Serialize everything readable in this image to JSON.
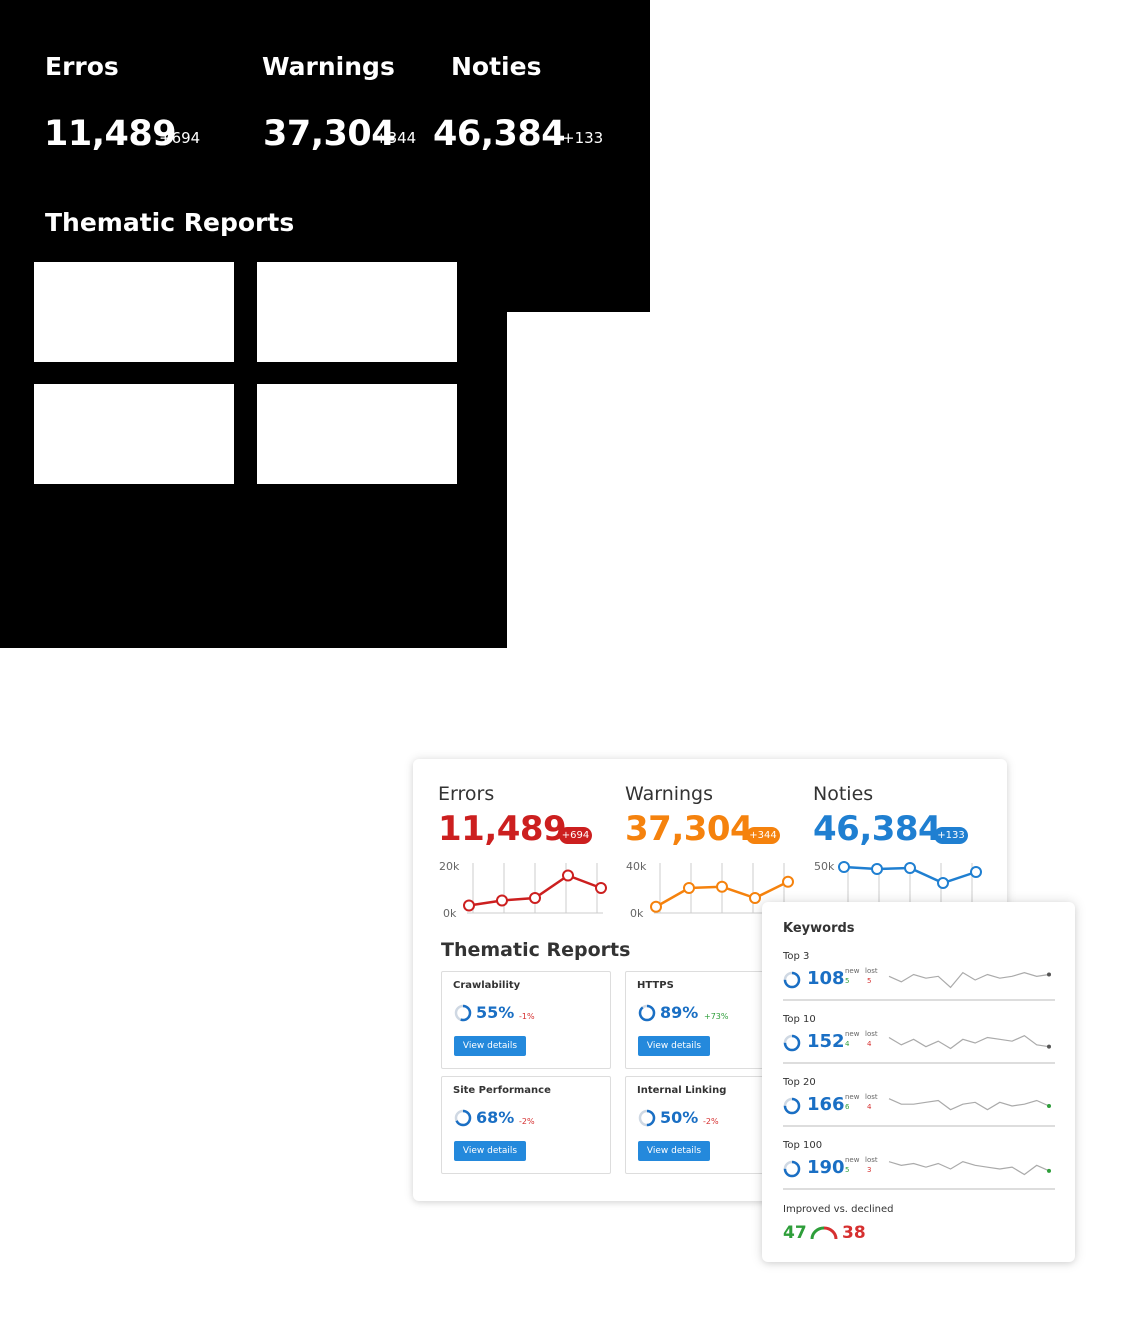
{
  "dark": {
    "errors_label": "Erros",
    "warnings_label": "Warnings",
    "notices_label": "Noties",
    "errors_value": "11,489",
    "errors_delta": "+694",
    "warnings_value": "37,304",
    "warnings_delta": "+344",
    "notices_value": "46,384",
    "notices_delta": "+133",
    "section_title": "Thematic Reports"
  },
  "card": {
    "errors": {
      "label": "Errors",
      "value": "11,489",
      "badge": "+694",
      "y_max": "20k",
      "y_min": "0k",
      "series": [
        3,
        5,
        6,
        15,
        10
      ],
      "max": 20,
      "color": "#cc1f1f"
    },
    "warnings": {
      "label": "Warnings",
      "value": "37,304",
      "badge": "+344",
      "y_max": "40k",
      "y_min": "0k",
      "series": [
        5,
        20,
        21,
        12,
        25
      ],
      "max": 40,
      "color": "#f5820d"
    },
    "notices": {
      "label": "Noties",
      "value": "46,384",
      "badge": "+133",
      "y_max": "50k",
      "y_min": "",
      "series": [
        46,
        44,
        45,
        30,
        41
      ],
      "max": 50,
      "color": "#1f7fd1"
    },
    "section_title": "Thematic Reports",
    "reports": [
      {
        "title": "Crawlability",
        "pct": "55%",
        "delta": "-1%",
        "value": 0.55,
        "button": "View details"
      },
      {
        "title": "HTTPS",
        "pct": "89%",
        "delta": "+73%",
        "value": 0.89,
        "button": "View details"
      },
      {
        "title": "Site Performance",
        "pct": "68%",
        "delta": "-2%",
        "value": 0.68,
        "button": "View details"
      },
      {
        "title": "Internal Linking",
        "pct": "50%",
        "delta": "-2%",
        "value": 0.5,
        "button": "View details"
      }
    ]
  },
  "keywords": {
    "title": "Keywords",
    "new_label": "new",
    "lost_label": "lost",
    "rows": [
      {
        "label": "Top 3",
        "value": "108",
        "new": "5",
        "lost": "5",
        "spark": [
          8,
          5,
          9,
          7,
          8,
          2,
          10,
          6,
          9,
          7,
          8,
          10,
          8,
          9
        ],
        "end_color": "#555"
      },
      {
        "label": "Top 10",
        "value": "152",
        "new": "4",
        "lost": "4",
        "spark": [
          9,
          5,
          8,
          4,
          7,
          3,
          8,
          6,
          9,
          8,
          7,
          10,
          5,
          4
        ],
        "end_color": "#555"
      },
      {
        "label": "Top 20",
        "value": "166",
        "new": "6",
        "lost": "4",
        "spark": [
          10,
          7,
          7,
          8,
          9,
          4,
          7,
          8,
          4,
          8,
          6,
          7,
          9,
          6
        ],
        "end_color": "#2e9e3a"
      },
      {
        "label": "Top 100",
        "value": "190",
        "new": "5",
        "lost": "3",
        "spark": [
          10,
          8,
          9,
          7,
          9,
          6,
          10,
          8,
          7,
          6,
          7,
          3,
          8,
          5
        ],
        "end_color": "#2e9e3a"
      }
    ],
    "improved_label": "Improved vs. declined",
    "improved": "47",
    "declined": "38"
  }
}
